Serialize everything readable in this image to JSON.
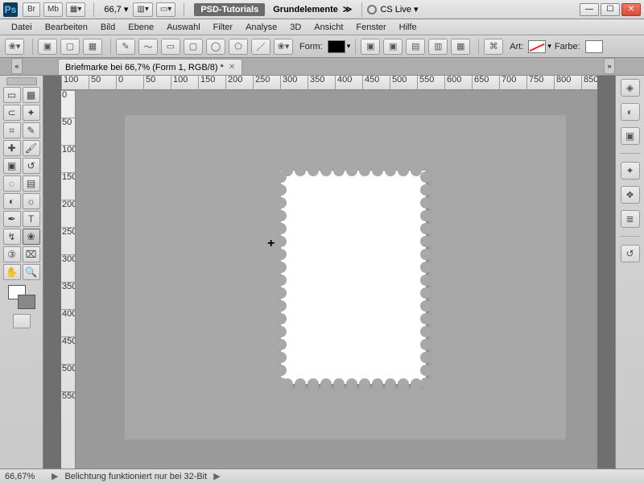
{
  "titlebar": {
    "ps": "Ps",
    "btn_br": "Br",
    "btn_mb": "Mb",
    "zoom": "66,7",
    "psd_tutorials": "PSD-Tutorials",
    "workspace_name": "Grundelemente",
    "cslive": "CS Live"
  },
  "menu": [
    "Datei",
    "Bearbeiten",
    "Bild",
    "Ebene",
    "Auswahl",
    "Filter",
    "Analyse",
    "3D",
    "Ansicht",
    "Fenster",
    "Hilfe"
  ],
  "options": {
    "form_label": "Form:",
    "art_label": "Art:",
    "farbe_label": "Farbe:"
  },
  "document": {
    "tab_title": "Briefmarke bei 66,7% (Form 1, RGB/8) *"
  },
  "ruler": {
    "h": [
      "100",
      "50",
      "0",
      "50",
      "100",
      "150",
      "200",
      "250",
      "300",
      "350",
      "400",
      "450",
      "500",
      "550",
      "600",
      "650",
      "700",
      "750",
      "800",
      "850"
    ],
    "v": [
      "0",
      "50",
      "100",
      "150",
      "200",
      "250",
      "300",
      "350",
      "400",
      "450",
      "500",
      "550"
    ]
  },
  "tools": {
    "names": [
      "move",
      "marquee",
      "lasso",
      "magic-wand",
      "crop",
      "eyedropper",
      "spot-heal",
      "brush",
      "clone",
      "history-brush",
      "eraser",
      "gradient",
      "blur",
      "dodge",
      "pen",
      "type",
      "path-select",
      "custom-shape",
      "3d",
      "3d-camera",
      "hand",
      "zoom"
    ],
    "glyphs": [
      "▭",
      "▦",
      "⊂",
      "✦",
      "⌗",
      "✎",
      "✚",
      "🖌",
      "▣",
      "↺",
      "◌",
      "▤",
      "◐",
      "☼",
      "✒",
      "T",
      "↯",
      "❀",
      "③",
      "⌧",
      "✋",
      "🔍"
    ]
  },
  "right_icons": [
    "layers",
    "adjust",
    "mask",
    "ruler",
    "swatches",
    "styles",
    "history"
  ],
  "status": {
    "zoom": "66,67%",
    "info": "Belichtung funktioniert nur bei 32-Bit"
  }
}
